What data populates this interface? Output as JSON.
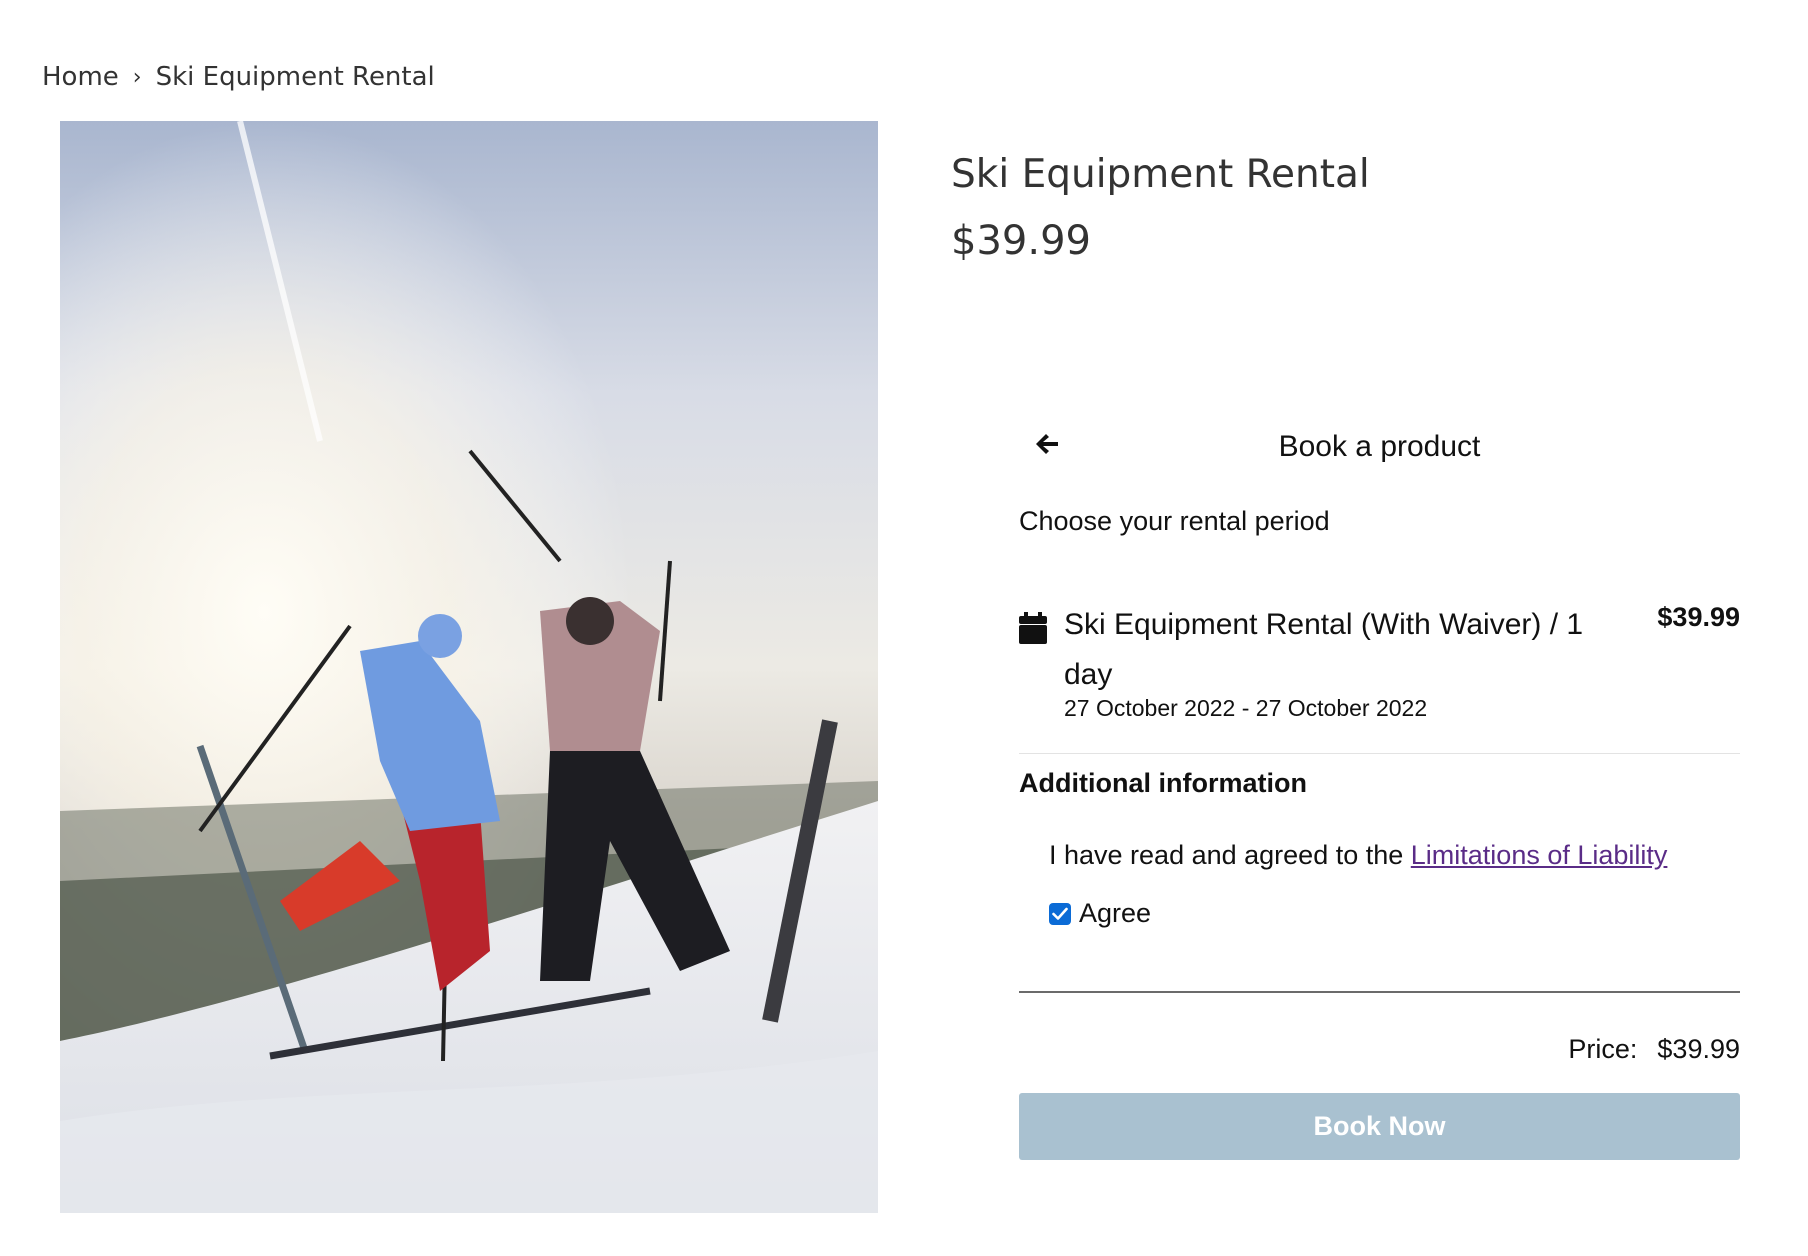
{
  "breadcrumb": {
    "home": "Home",
    "separator": "›",
    "current": "Ski Equipment Rental"
  },
  "product": {
    "title": "Ski Equipment Rental",
    "price": "$39.99",
    "image": "two-skiers-celebrating-on-snowy-slope"
  },
  "booking": {
    "back_icon": "arrow-left-icon",
    "title": "Book a product",
    "rental_label": "Choose your rental period",
    "item": {
      "icon": "calendar-icon",
      "name": "Ski Equipment Rental (With Waiver) / 1 day",
      "price": "$39.99",
      "dates": "27 October 2022 - 27 October 2022"
    },
    "additional_title": "Additional information",
    "waiver_prefix": "I have read and agreed to the ",
    "waiver_link": "Limitations of Liability",
    "agree_label": "Agree",
    "agree_checked": true,
    "price_label": "Price:",
    "price_value": "$39.99",
    "book_button": "Book Now"
  },
  "colors": {
    "link": "#5a2c87",
    "checkbox": "#0b6bd6",
    "book_button_bg": "#a9c1d0",
    "book_button_text": "#ffffff"
  }
}
